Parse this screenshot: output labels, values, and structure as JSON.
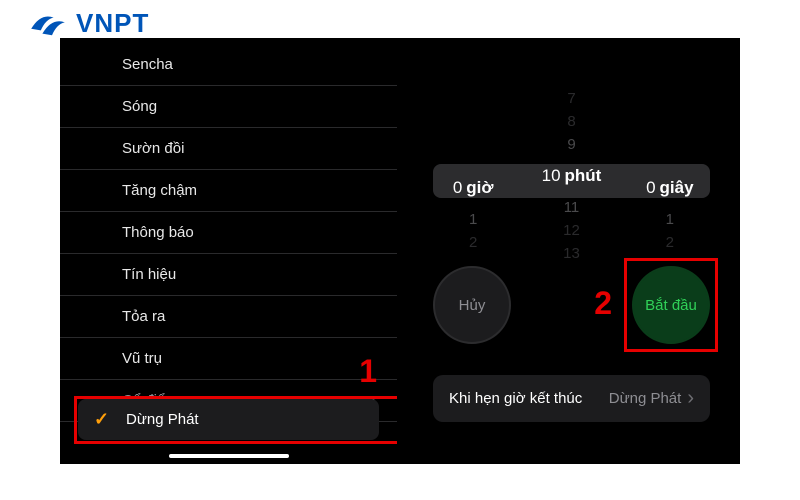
{
  "logo": {
    "text": "VNPT"
  },
  "left": {
    "items": [
      "Sencha",
      "Sóng",
      "Sườn đồi",
      "Tăng chậm",
      "Thông báo",
      "Tín hiệu",
      "Tỏa ra",
      "Vũ trụ"
    ],
    "section_label": "Cổ điển",
    "selected": "Dừng Phát",
    "annotation": "1"
  },
  "right": {
    "picker": {
      "hours": {
        "value": "0",
        "unit": "giờ",
        "below": [
          "1",
          "2"
        ]
      },
      "minutes": {
        "above": [
          "7",
          "8",
          "9"
        ],
        "value": "10",
        "unit": "phút",
        "below": [
          "11",
          "12",
          "13"
        ]
      },
      "seconds": {
        "value": "0",
        "unit": "giây",
        "below": [
          "1",
          "2"
        ]
      }
    },
    "cancel": "Hủy",
    "start": "Bắt đầu",
    "annotation": "2",
    "end_label": "Khi hẹn giờ kết thúc",
    "end_value": "Dừng Phát"
  }
}
